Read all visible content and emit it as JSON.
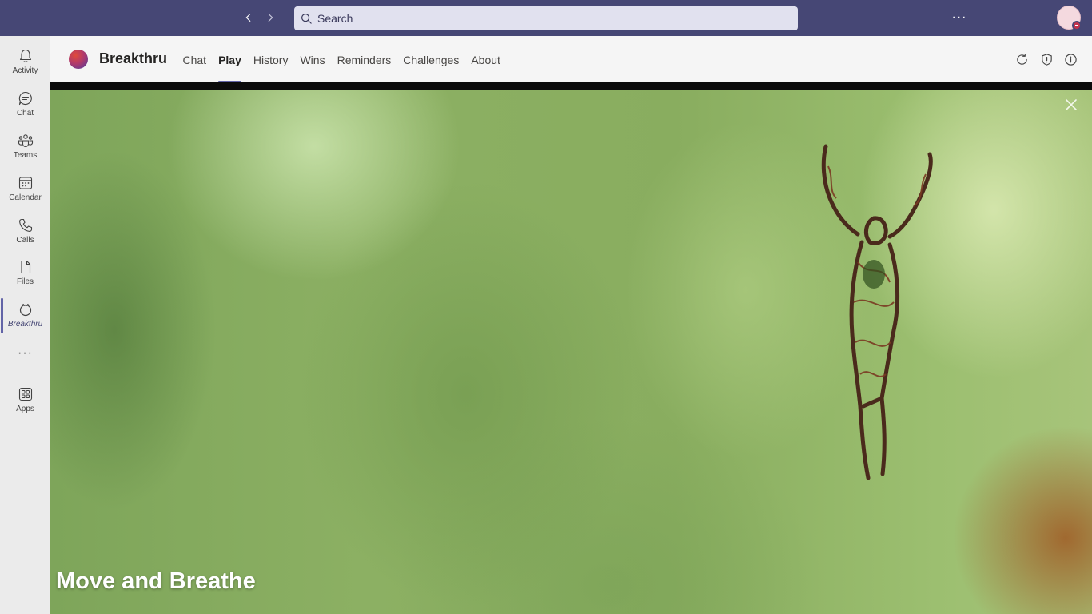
{
  "topbar": {
    "search": {
      "placeholder": "Search"
    },
    "more_label": "···"
  },
  "rail": {
    "items": [
      {
        "label": "Activity",
        "icon": "bell-icon"
      },
      {
        "label": "Chat",
        "icon": "chat-icon"
      },
      {
        "label": "Teams",
        "icon": "teams-icon"
      },
      {
        "label": "Calendar",
        "icon": "calendar-icon"
      },
      {
        "label": "Calls",
        "icon": "phone-icon"
      },
      {
        "label": "Files",
        "icon": "file-icon"
      },
      {
        "label": "Breakthru",
        "icon": "breakthru-icon",
        "active": true
      },
      {
        "label": "Apps",
        "icon": "apps-icon"
      }
    ],
    "more_label": "···"
  },
  "app": {
    "name": "Breakthru",
    "tabs": [
      {
        "label": "Chat"
      },
      {
        "label": "Play",
        "active": true
      },
      {
        "label": "History"
      },
      {
        "label": "Wins"
      },
      {
        "label": "Reminders"
      },
      {
        "label": "Challenges"
      },
      {
        "label": "About"
      }
    ],
    "header_icons": [
      "refresh-icon",
      "shield-icon",
      "info-icon"
    ]
  },
  "stage": {
    "title": "Move and Breathe"
  },
  "colors": {
    "title_bar": "#464775",
    "accent": "#6264a7",
    "presence_busy": "#c4314b"
  }
}
